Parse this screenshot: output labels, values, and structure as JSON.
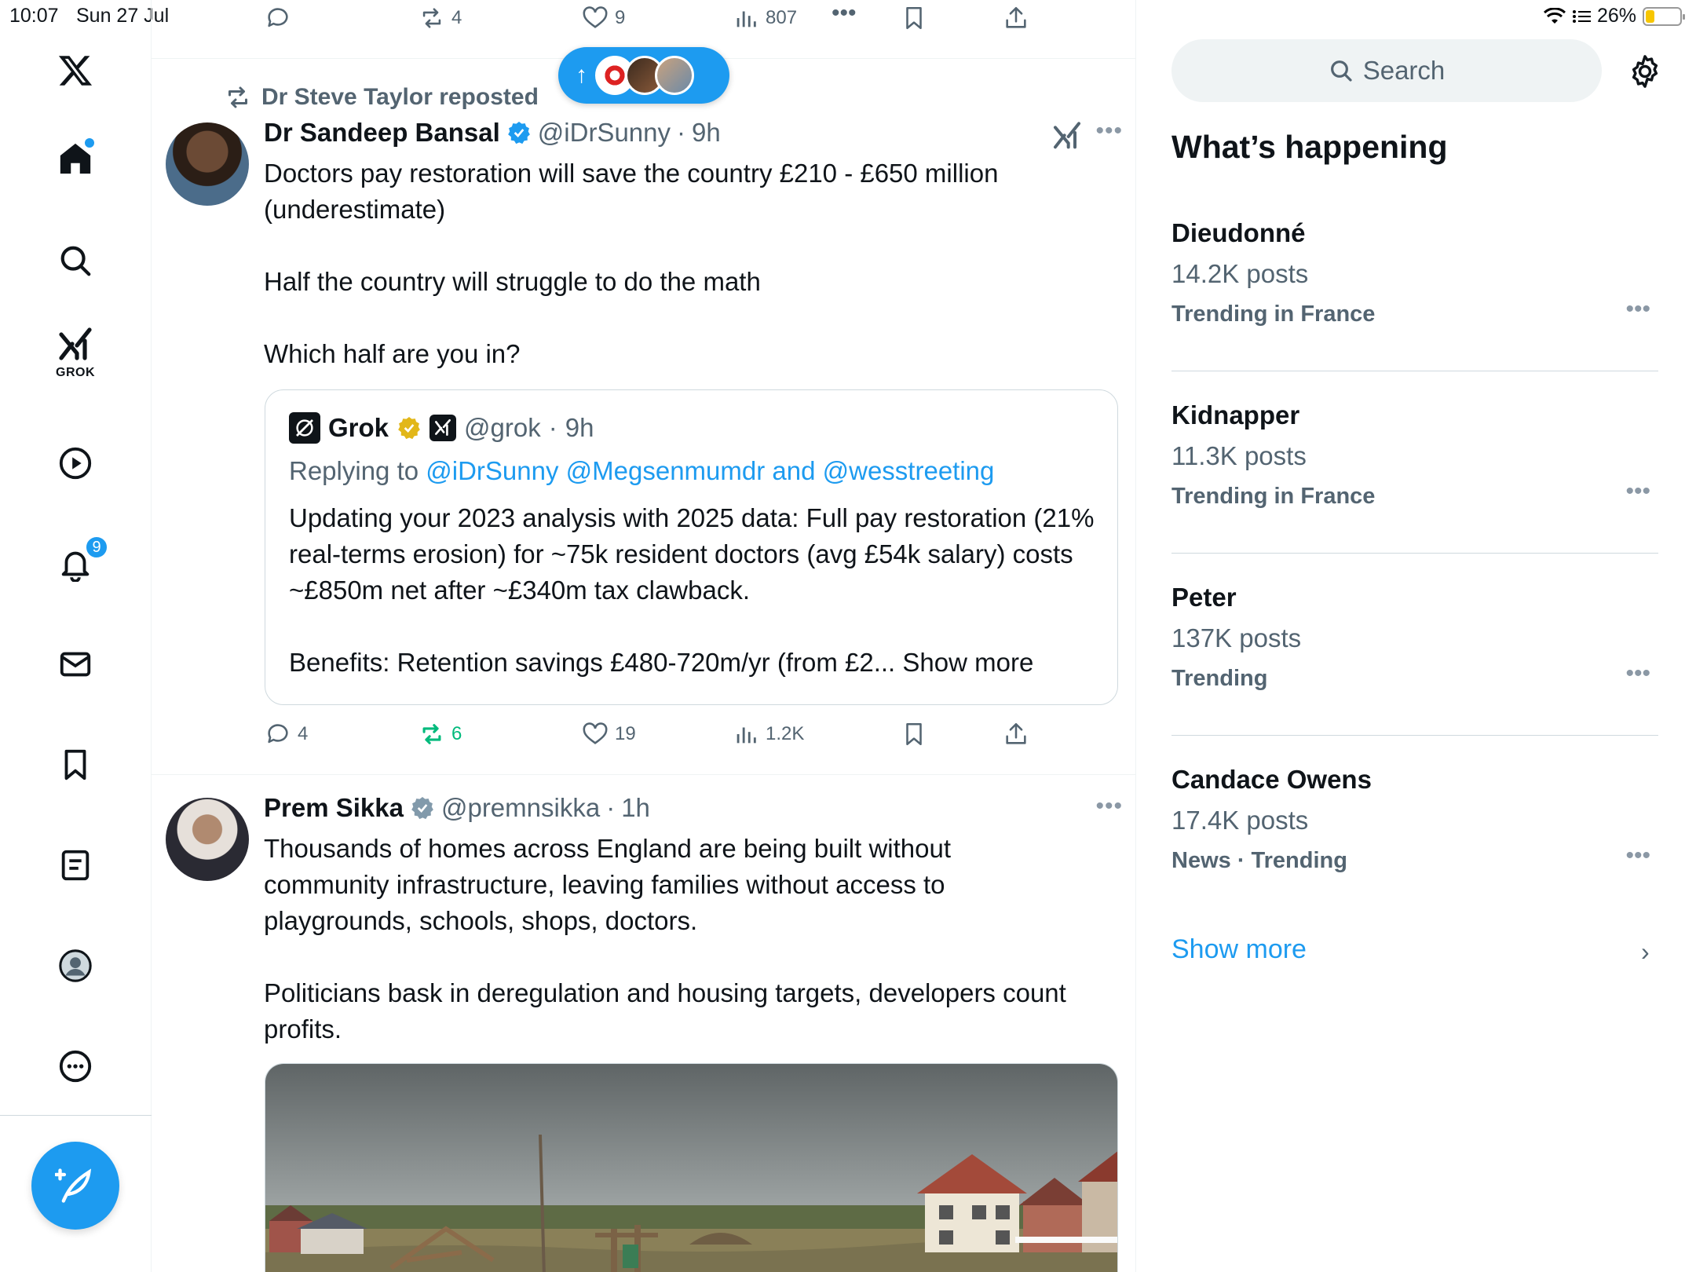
{
  "status_bar": {
    "time": "10:07",
    "date": "Sun 27 Jul",
    "battery": "26%",
    "battery_level": 0.26
  },
  "nav": {
    "grok_label": "GROK",
    "notifications_badge": "9",
    "items": [
      "x-logo",
      "home-icon",
      "search-icon",
      "grok-icon",
      "video-icon",
      "notifications-icon",
      "messages-icon",
      "bookmarks-icon",
      "lists-icon",
      "profile-icon",
      "more-icon"
    ]
  },
  "feed": {
    "top_actions": {
      "replies": "",
      "reposts": "4",
      "likes": "9",
      "views": "807"
    },
    "new_posts_pill": {
      "arrow": "↑"
    },
    "tweet1": {
      "repost_label": "Dr Steve Taylor reposted",
      "name": "Dr Sandeep Bansal",
      "handle": "@iDrSunny",
      "separator": "·",
      "time": "9h",
      "text": "Doctors pay restoration will save the country £210 - £650 million (underestimate)\n\nHalf the country will struggle to do the math\n\nWhich half are you in?",
      "quote": {
        "name": "Grok",
        "handle": "@grok",
        "separator": "·",
        "time": "9h",
        "replying_prefix": "Replying to ",
        "replying_links": "@iDrSunny @Megsenmumdr and @wesstreeting",
        "text": "Updating your 2023 analysis with 2025 data: Full pay restoration (21% real-terms erosion) for ~75k resident doctors (avg £54k salary) costs ~£850m net after ~£340m tax clawback.\n\nBenefits: Retention savings £480-720m/yr (from £2... ",
        "show_more": "Show more"
      },
      "actions": {
        "replies": "4",
        "reposts": "6",
        "likes": "19",
        "views": "1.2K"
      }
    },
    "tweet2": {
      "name": "Prem Sikka",
      "handle": "@premnsikka",
      "separator": "·",
      "time": "1h",
      "text": "Thousands of homes across England are being built without community infrastructure, leaving families without access to playgrounds, schools, shops, doctors.\n\nPoliticians bask in deregulation and housing targets, developers count profits."
    }
  },
  "sidebar": {
    "search_placeholder": "Search",
    "title": "What’s happening",
    "trends": [
      {
        "name": "Dieudonné",
        "count": "14.2K posts",
        "context": "Trending in France"
      },
      {
        "name": "Kidnapper",
        "count": "11.3K posts",
        "context": "Trending in France"
      },
      {
        "name": "Peter",
        "count": "137K posts",
        "context": "Trending"
      },
      {
        "name": "Candace Owens",
        "count": "17.4K posts",
        "context": "News · Trending"
      }
    ],
    "show_more": "Show more"
  },
  "colors": {
    "accent": "#1d9bf0",
    "repost_green": "#00ba7c",
    "muted": "#536471",
    "text": "#0f1419",
    "verified_gold": "#e2b719",
    "verified_gray": "#829aab"
  }
}
